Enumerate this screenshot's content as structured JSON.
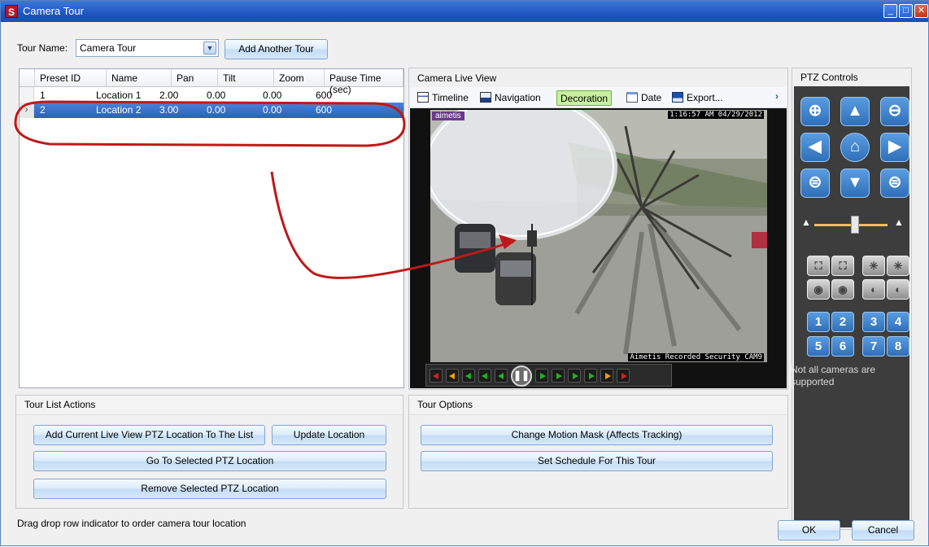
{
  "window": {
    "title": "Camera Tour",
    "app_letter": "S"
  },
  "tour": {
    "name_label": "Tour Name:",
    "name_value": "Camera Tour",
    "add_tour_label": "Add Another Tour"
  },
  "grid": {
    "columns": [
      "Preset ID",
      "Name",
      "Pan",
      "Tilt",
      "Zoom",
      "Pause Time (sec)"
    ],
    "rows": [
      [
        "1",
        "Location 1",
        "2.00",
        "0.00",
        "0.00",
        "600"
      ],
      [
        "2",
        "Location 2",
        "3.00",
        "0.00",
        "0.00",
        "600"
      ]
    ],
    "selected_index": 1
  },
  "camera": {
    "title": "Camera Live View",
    "toolbar": {
      "timeline": "Timeline",
      "navigation": "Navigation",
      "decoration": "Decoration",
      "date": "Date",
      "export": "Export..."
    },
    "logo_text": "aimetis",
    "timestamp": "1:16:57 AM 04/29/2012",
    "footer_text": "Aimetis Recorded Security CAM9"
  },
  "ptz": {
    "title": "PTZ Controls",
    "presets": [
      "1",
      "2",
      "3",
      "4",
      "5",
      "6",
      "7",
      "8"
    ],
    "note": "Not all cameras are supported"
  },
  "tour_actions": {
    "title": "Tour List Actions",
    "add_label": "Add Current Live View PTZ Location To The List",
    "update_label": "Update Location",
    "goto_label": "Go To Selected PTZ Location",
    "remove_label": "Remove Selected PTZ Location"
  },
  "tour_options": {
    "title": "Tour Options",
    "motion_mask_label": "Change Motion Mask (Affects Tracking)",
    "schedule_label": "Set Schedule For This Tour"
  },
  "footer": {
    "hint": "Drag  drop row indicator to order camera tour location",
    "ok_label": "OK",
    "cancel_label": "Cancel"
  },
  "colors": {
    "selection": "#3a6fcc",
    "annotation": "#c01818",
    "ptz_background": "#3d3d3d",
    "ptz_button": "#3f80c8",
    "decoration_active": "#c8f0a0"
  },
  "icons": [
    "app-icon",
    "dropdown-arrow-icon",
    "timeline-icon",
    "navigation-icon",
    "date-icon",
    "export-icon",
    "minimize-icon",
    "maximize-icon",
    "close-icon"
  ]
}
